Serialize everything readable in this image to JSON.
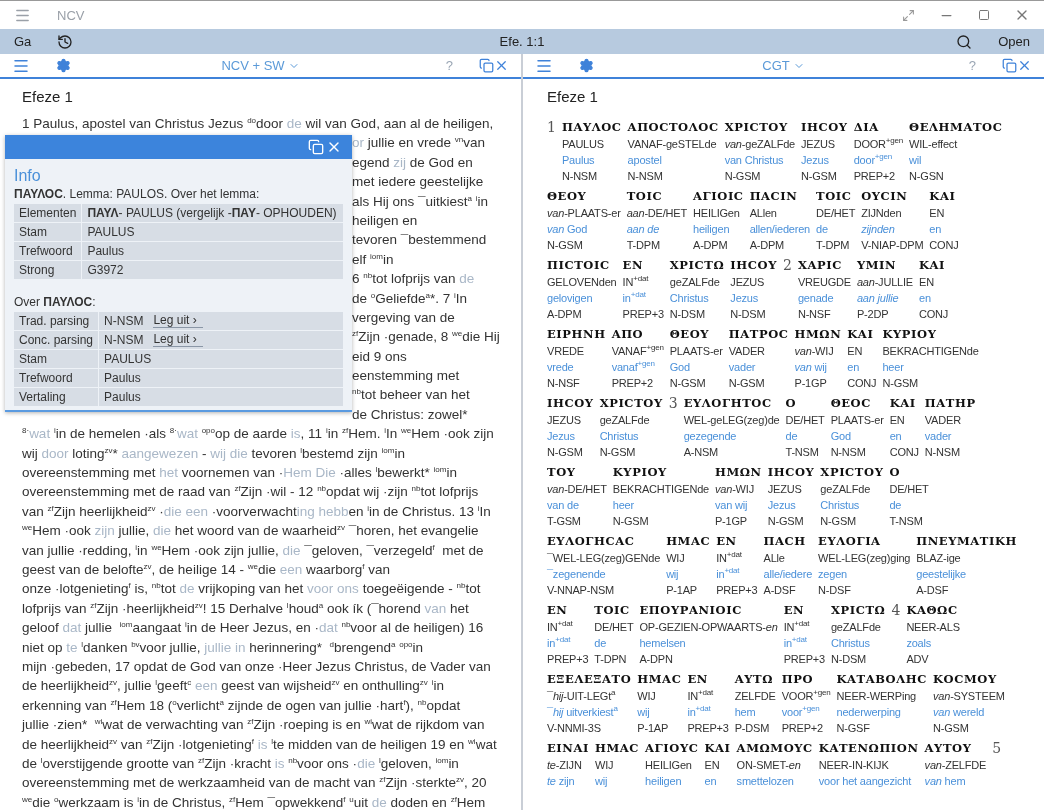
{
  "window": {
    "title": "NCV"
  },
  "toolbar": {
    "go": "Ga",
    "reference": "Efe. 1:1",
    "open": "Open"
  },
  "left_panel": {
    "version": "NCV + SW",
    "help": "?",
    "heading": "Efeze 1",
    "lines": [
      {
        "covered": false,
        "parts": [
          {
            "text": "1 Paulus, apostel van Christus Jezus $^{do}$door ",
            "faded": false
          },
          {
            "text": "de",
            "faded": true
          },
          {
            "text": " wil van God, aan al de heiligen,",
            "faded": false
          }
        ]
      },
      {
        "covered": true,
        "parts": [
          {
            "text": "or",
            "faded": true
          },
          {
            "text": " jullie en vrede $^{vn}$van",
            "faded": false
          }
        ]
      },
      {
        "covered": true,
        "parts": [
          {
            "text": "egend ",
            "faded": false
          },
          {
            "text": "zij",
            "faded": true
          },
          {
            "text": " de God en",
            "faded": false
          }
        ]
      },
      {
        "covered": true,
        "parts": [
          {
            "text": "met iedere geestelijke",
            "faded": false
          }
        ]
      },
      {
        "covered": true,
        "parts": [
          {
            "text": "als Hij ons ¯uitkiest$^{a}$ $^{i}$in",
            "faded": false
          }
        ]
      },
      {
        "covered": true,
        "parts": [
          {
            "text": "heiligen en",
            "faded": false
          }
        ]
      },
      {
        "covered": true,
        "parts": [
          {
            "text": "tevoren ¯bestemmend",
            "faded": false
          }
        ]
      },
      {
        "covered": true,
        "parts": [
          {
            "text": "elf $^{iom}$in",
            "faded": false
          }
        ]
      },
      {
        "covered": true,
        "parts": [
          {
            "text": "6 $^{nb}$tot lofprijs van ",
            "faded": false
          },
          {
            "text": "de",
            "faded": true
          }
        ]
      },
      {
        "covered": true,
        "parts": [
          {
            "text": "de $^{o}$Geliefde$^{a}$*. 7 $^{i}$In",
            "faded": false
          }
        ]
      },
      {
        "covered": true,
        "parts": [
          {
            "text": "vergeving van de",
            "faded": false
          }
        ]
      },
      {
        "covered": true,
        "parts": [
          {
            "text": "$^{zf}$Zijn ·genade, 8 $^{we}$die Hij",
            "faded": false
          }
        ]
      },
      {
        "covered": true,
        "parts": [
          {
            "text": "eid 9 ons",
            "faded": false
          }
        ]
      },
      {
        "covered": true,
        "parts": [
          {
            "text": "eenstemming met",
            "faded": false
          }
        ]
      },
      {
        "covered": true,
        "parts": [
          {
            "text": "$^{nb}$tot beheer van het",
            "faded": false
          }
        ]
      },
      {
        "covered": true,
        "parts": [
          {
            "text": "de Christus: zowel*",
            "faded": false
          }
        ]
      },
      {
        "covered": false,
        "parts": [
          {
            "text": "$^{8·}$",
            "faded": false
          },
          {
            "text": "wat",
            "faded": true
          },
          {
            "text": " $^{i}$in de hemelen ·als $^{8·}$",
            "faded": false
          },
          {
            "text": "wat",
            "faded": true
          },
          {
            "text": " $^{opo}$op de aarde ",
            "faded": false
          },
          {
            "text": "is",
            "faded": true
          },
          {
            "text": ", 11 $^{i}$in $^{zf}$Hem. $^{i}$In $^{we}$Hem ·ook zijn",
            "faded": false
          }
        ]
      },
      {
        "covered": false,
        "parts": [
          {
            "text": "wij ",
            "faded": false
          },
          {
            "text": "door",
            "faded": true
          },
          {
            "text": " loting$^{zv}$* ",
            "faded": false
          },
          {
            "text": "aangewezen",
            "faded": true
          },
          {
            "text": " - ",
            "faded": false
          },
          {
            "text": "wij die",
            "faded": true
          },
          {
            "text": " tevoren $^{l}$bestemd zijn $^{iom}$in",
            "faded": false
          }
        ]
      },
      {
        "covered": false,
        "parts": [
          {
            "text": "overeenstemming met ",
            "faded": false
          },
          {
            "text": "het",
            "faded": true
          },
          {
            "text": " voornemen van ·",
            "faded": false
          },
          {
            "text": "Hem Die",
            "faded": true
          },
          {
            "text": " ·alles $^{l}$bewerkt* $^{iom}$in",
            "faded": false
          }
        ]
      },
      {
        "covered": false,
        "parts": [
          {
            "text": "overeenstemming met de raad van $^{zf}$Zijn ·wil - 12 $^{nb}$opdat wij ·zijn $^{nb}$tot lofprijs",
            "faded": false
          }
        ]
      },
      {
        "covered": false,
        "parts": [
          {
            "text": "van $^{zf}$Zijn heerlijkheid$^{zv}$ ·",
            "faded": false
          },
          {
            "text": "die een",
            "faded": true
          },
          {
            "text": " ·voorverwacht",
            "faded": false
          },
          {
            "text": "ing hebb",
            "faded": true
          },
          {
            "text": "en $^{i}$in de Christus. 13 $^{i}$In",
            "faded": false
          }
        ]
      },
      {
        "covered": false,
        "parts": [
          {
            "text": "$^{we}$Hem ·ook ",
            "faded": false
          },
          {
            "text": "zijn",
            "faded": true
          },
          {
            "text": " jullie, ",
            "faded": false
          },
          {
            "text": "die",
            "faded": true
          },
          {
            "text": " het woord van de waarheid$^{zv}$ ¯horen, het evangelie",
            "faded": false
          }
        ]
      },
      {
        "covered": false,
        "parts": [
          {
            "text": "van jullie ·redding, $^{i}$in $^{we}$Hem ·ook zijn jullie, ",
            "faded": false
          },
          {
            "text": "die",
            "faded": true
          },
          {
            "text": " ¯geloven, ¯verzegeld$^{f}$  met de",
            "faded": false
          }
        ]
      },
      {
        "covered": false,
        "parts": [
          {
            "text": "geest van de belofte$^{zv}$, de heilige 14 - $^{we}$die ",
            "faded": false
          },
          {
            "text": "een",
            "faded": true
          },
          {
            "text": " waarborg$^{f}$ van",
            "faded": false
          }
        ]
      },
      {
        "covered": false,
        "parts": [
          {
            "text": "onze ·lotgenieting$^{f}$ is, $^{nb}$tot ",
            "faded": false
          },
          {
            "text": "de",
            "faded": true
          },
          {
            "text": " vrijkoping van het ",
            "faded": false
          },
          {
            "text": "voor ons",
            "faded": true
          },
          {
            "text": " toegeëigende - $^{nb}$tot",
            "faded": false
          }
        ]
      },
      {
        "covered": false,
        "parts": [
          {
            "text": "lofprijs van $^{zf}$Zijn ·heerlijkheid$^{zv}$! 15 Derhalve $^{l}$houd$^{a}$ ook ík (¯horend ",
            "faded": false
          },
          {
            "text": "van",
            "faded": true
          },
          {
            "text": " het",
            "faded": false
          }
        ]
      },
      {
        "covered": false,
        "parts": [
          {
            "text": "geloof ",
            "faded": false
          },
          {
            "text": "dat",
            "faded": true
          },
          {
            "text": " jullie  $^{iom}$aangaat $^{i}$in de Heer Jezus, en ·",
            "faded": false
          },
          {
            "text": "dat",
            "faded": true
          },
          {
            "text": " $^{nb}$voor al de heiligen) 16",
            "faded": false
          }
        ]
      },
      {
        "covered": false,
        "parts": [
          {
            "text": "niet op ",
            "faded": false
          },
          {
            "text": "te",
            "faded": true
          },
          {
            "text": " $^{l}$danken $^{bv}$voor jullie, ",
            "faded": false
          },
          {
            "text": "jullie in",
            "faded": true
          },
          {
            "text": " herinnering*  $^{d}$brengend$^{a}$ $^{opo}$in",
            "faded": false
          }
        ]
      },
      {
        "covered": false,
        "parts": [
          {
            "text": "mijn ·gebeden, 17 opdat de God van onze ·Heer Jezus Christus, de Vader van",
            "faded": false
          }
        ]
      },
      {
        "covered": false,
        "parts": [
          {
            "text": "de heerlijkheid$^{zv}$, jullie $^{l}$geeft$^{c}$ ",
            "faded": false
          },
          {
            "text": "een",
            "faded": true
          },
          {
            "text": " geest van wijsheid$^{zv}$ en onthulling$^{zv}$ $^{i}$in",
            "faded": false
          }
        ]
      },
      {
        "covered": false,
        "parts": [
          {
            "text": "erkenning van $^{zf}$Hem 18 ($^{o}$verlicht$^{a}$ zijnde de ogen van jullie ·hart$^{f}$), $^{nb}$opdat",
            "faded": false
          }
        ]
      },
      {
        "covered": false,
        "parts": [
          {
            "text": "jullie ·zien*  $^{wi}$wat de verwachting van $^{zf}$Zijn ·roeping is en $^{wi}$wat de rijkdom van",
            "faded": false
          }
        ]
      },
      {
        "covered": false,
        "parts": [
          {
            "text": "de heerlijkheid$^{zv}$ van $^{zf}$Zijn ·lotgenieting$^{f}$ ",
            "faded": false
          },
          {
            "text": "is",
            "faded": true
          },
          {
            "text": " $^{l}$te midden van de heiligen 19 en $^{wi}$wat",
            "faded": false
          }
        ]
      },
      {
        "covered": false,
        "parts": [
          {
            "text": "de $^{l}$overstijgende grootte van $^{zf}$Zijn ·kracht ",
            "faded": false
          },
          {
            "text": "is",
            "faded": true
          },
          {
            "text": " $^{nb}$voor ons ·",
            "faded": false
          },
          {
            "text": "die",
            "faded": true
          },
          {
            "text": " $^{l}$geloven, $^{iom}$in",
            "faded": false
          }
        ]
      },
      {
        "covered": false,
        "parts": [
          {
            "text": "overeenstemming met de werkzaamheid van de macht van $^{zf}$Zijn ·sterkte$^{zv}$, 20",
            "faded": false
          }
        ]
      },
      {
        "covered": false,
        "parts": [
          {
            "text": "$^{we}$die $^{o}$werkzaam is $^{i}$in de Christus, $^{zf}$Hem ¯opwekkend$^{f}$ $^{u}$uit ",
            "faded": false
          },
          {
            "text": "de",
            "faded": true
          },
          {
            "text": " doden en $^{zf}$Hem",
            "faded": false
          }
        ]
      }
    ]
  },
  "info_popup": {
    "title": "Info",
    "lemma": "**ΠΑΥΛΟϹ**. Lemma: PAULOS. Over het lemma:",
    "lemma_rows": [
      {
        "label": "Elementen",
        "value": "**ΠΑΥΛ**- PAULUS (vergelijk -**ΠΑΥ**- OPHOUDEN)"
      },
      {
        "label": "Stam",
        "value": "PAULUS"
      },
      {
        "label": "Trefwoord",
        "value": "Paulus"
      },
      {
        "label": "Strong",
        "value": "G3972"
      }
    ],
    "word_heading": "Over **ΠΑΥΛΟϹ**:",
    "word_rows": [
      {
        "label": "Trad. parsing",
        "value": "N-NSM",
        "action": "Leg uit ›"
      },
      {
        "label": "Conc. parsing",
        "value": "N-NSM",
        "action": "Leg uit ›"
      },
      {
        "label": "Stam",
        "value": "PAULUS"
      },
      {
        "label": "Trefwoord",
        "value": "Paulus"
      },
      {
        "label": "Vertaling",
        "value": "Paulus"
      }
    ]
  },
  "right_panel": {
    "version": "CGT",
    "help": "?",
    "heading": "Efeze 1",
    "lines": [
      {
        "items": [
          {
            "kind": "verse",
            "number": "1"
          },
          {
            "kind": "word",
            "greek": "ΠΑΥΛΟϹ",
            "literal": "PAULUS",
            "translation": "Paulus",
            "parsing": "N-NSM"
          },
          {
            "kind": "word",
            "greek": "ΑΠΟϹΤΟΛΟϹ",
            "literal": "VANAF-geSTELde",
            "translation": "apostel",
            "parsing": "N-NSM"
          },
          {
            "kind": "word",
            "greek": "ΧΡΙϹΤΟΥ",
            "literal": "*van*-geZALFde",
            "translation": "van Christus",
            "parsing": "N-GSM"
          },
          {
            "kind": "word",
            "greek": "ΙΗϹΟΥ",
            "literal": "JEZUS",
            "translation": "Jezus",
            "parsing": "N-GSM"
          },
          {
            "kind": "word",
            "greek": "ΔΙΑ",
            "literal": "DOOR$^{+gen}$",
            "translation": "door$^{+gen}$",
            "parsing": "PREP+2"
          },
          {
            "kind": "word",
            "greek": "ΘΕΛΗΜΑΤΟϹ",
            "literal": "WIL-effect",
            "translation": "wil",
            "parsing": "N-GSN"
          }
        ]
      },
      {
        "items": [
          {
            "kind": "word",
            "greek": "ΘΕΟΥ",
            "literal": "*van*-PLAATS-er",
            "translation": "*van* God",
            "parsing": "N-GSM"
          },
          {
            "kind": "word",
            "greek": "ΤΟΙϹ",
            "literal": "*aan*-DE/HET",
            "translation": "*aan de*",
            "parsing": "T-DPM"
          },
          {
            "kind": "word",
            "greek": "ΑΓΙΟΙϹ",
            "literal": "HEILIGen",
            "translation": "heiligen",
            "parsing": "A-DPM"
          },
          {
            "kind": "word",
            "greek": "ΠΑϹΙΝ",
            "literal": "ALlen",
            "translation": "allen/iederen",
            "parsing": "A-DPM"
          },
          {
            "kind": "word",
            "greek": "ΤΟΙϹ",
            "literal": "DE/HET",
            "translation": "de",
            "parsing": "T-DPM"
          },
          {
            "kind": "word",
            "greek": "ΟΥϹΙΝ",
            "literal": "ZIJNden",
            "translation": "*zijnden*",
            "parsing": "V-NIAP-DPM"
          },
          {
            "kind": "word",
            "greek": "ΚΑΙ",
            "literal": "EN",
            "translation": "en",
            "parsing": "CONJ"
          }
        ]
      },
      {
        "items": [
          {
            "kind": "word",
            "greek": "ΠΙϹΤΟΙϹ",
            "literal": "GELOVENden",
            "translation": "gelovigen",
            "parsing": "A-DPM"
          },
          {
            "kind": "word",
            "greek": "ΕΝ",
            "literal": "IN$^{+dat}$",
            "translation": "in$^{+dat}$",
            "parsing": "PREP+3"
          },
          {
            "kind": "word",
            "greek": "ΧΡΙϹΤΩ",
            "literal": "geZALFde",
            "translation": "Christus",
            "parsing": "N-DSM"
          },
          {
            "kind": "word",
            "greek": "ΙΗϹΟΥ",
            "literal": "JEZUS",
            "translation": "Jezus",
            "parsing": "N-DSM"
          },
          {
            "kind": "verse",
            "number": "2"
          },
          {
            "kind": "word",
            "greek": "ΧΑΡΙϹ",
            "literal": "VREUGDE",
            "translation": "genade",
            "parsing": "N-NSF"
          },
          {
            "kind": "word",
            "greek": "ΥΜΙΝ",
            "literal": "*aan*-JULLIE",
            "translation": "*aan jullie*",
            "parsing": "P-2DP"
          },
          {
            "kind": "word",
            "greek": "ΚΑΙ",
            "literal": "EN",
            "translation": "en",
            "parsing": "CONJ"
          }
        ]
      },
      {
        "items": [
          {
            "kind": "word",
            "greek": "ΕΙΡΗΝΗ",
            "literal": "VREDE",
            "translation": "vrede",
            "parsing": "N-NSF"
          },
          {
            "kind": "word",
            "greek": "ΑΠΟ",
            "literal": "VANAF$^{+gen}$",
            "translation": "vanaf$^{+gen}$",
            "parsing": "PREP+2"
          },
          {
            "kind": "word",
            "greek": "ΘΕΟΥ",
            "literal": "PLAATS-er",
            "translation": "God",
            "parsing": "N-GSM"
          },
          {
            "kind": "word",
            "greek": "ΠΑΤΡΟϹ",
            "literal": "VADER",
            "translation": "vader",
            "parsing": "N-GSM"
          },
          {
            "kind": "word",
            "greek": "ΗΜΩΝ",
            "literal": "*van*-WIJ",
            "translation": "*van* wij",
            "parsing": "P-1GP"
          },
          {
            "kind": "word",
            "greek": "ΚΑΙ",
            "literal": "EN",
            "translation": "en",
            "parsing": "CONJ"
          },
          {
            "kind": "word",
            "greek": "ΚΥΡΙΟΥ",
            "literal": "BEKRACHTIGENde",
            "translation": "heer",
            "parsing": "N-GSM"
          }
        ]
      },
      {
        "items": [
          {
            "kind": "word",
            "greek": "ΙΗϹΟΥ",
            "literal": "JEZUS",
            "translation": "Jezus",
            "parsing": "N-GSM"
          },
          {
            "kind": "word",
            "greek": "ΧΡΙϹΤΟΥ",
            "literal": "geZALFde",
            "translation": "Christus",
            "parsing": "N-GSM"
          },
          {
            "kind": "verse",
            "number": "3"
          },
          {
            "kind": "word",
            "greek": "ΕΥΛΟΓΗΤΟϹ",
            "literal": "WEL-geLEG(zeg)de",
            "translation": "gezegende",
            "parsing": "A-NSM"
          },
          {
            "kind": "word",
            "greek": "Ο",
            "literal": "DE/HET",
            "translation": "de",
            "parsing": "T-NSM"
          },
          {
            "kind": "word",
            "greek": "ΘΕΟϹ",
            "literal": "PLAATS-er",
            "translation": "God",
            "parsing": "N-NSM"
          },
          {
            "kind": "word",
            "greek": "ΚΑΙ",
            "literal": "EN",
            "translation": "en",
            "parsing": "CONJ"
          },
          {
            "kind": "word",
            "greek": "ΠΑΤΗΡ",
            "literal": "VADER",
            "translation": "vader",
            "parsing": "N-NSM"
          }
        ]
      },
      {
        "items": [
          {
            "kind": "word",
            "greek": "ΤΟΥ",
            "literal": "*van*-DE/HET",
            "translation": "van de",
            "parsing": "T-GSM"
          },
          {
            "kind": "word",
            "greek": "ΚΥΡΙΟΥ",
            "literal": "BEKRACHTIGENde",
            "translation": "heer",
            "parsing": "N-GSM"
          },
          {
            "kind": "word",
            "greek": "ΗΜΩΝ",
            "literal": "*van*-WIJ",
            "translation": "van wij",
            "parsing": "P-1GP"
          },
          {
            "kind": "word",
            "greek": "ΙΗϹΟΥ",
            "literal": "JEZUS",
            "translation": "Jezus",
            "parsing": "N-GSM"
          },
          {
            "kind": "word",
            "greek": "ΧΡΙϹΤΟΥ",
            "literal": "geZALFde",
            "translation": "Christus",
            "parsing": "N-GSM"
          },
          {
            "kind": "word",
            "greek": "Ο",
            "literal": "DE/HET",
            "translation": "de",
            "parsing": "T-NSM"
          }
        ]
      },
      {
        "items": [
          {
            "kind": "word",
            "greek": "ΕΥΛΟΓΗϹΑϹ",
            "literal": "¯WEL-LEG(zeg)GENde",
            "translation": "¯zegenende",
            "parsing": "V-NNAP-NSM"
          },
          {
            "kind": "word",
            "greek": "ΗΜΑϹ",
            "literal": "WIJ",
            "translation": "wij",
            "parsing": "P-1AP"
          },
          {
            "kind": "word",
            "greek": "ΕΝ",
            "literal": "IN$^{+dat}$",
            "translation": "in$^{+dat}$",
            "parsing": "PREP+3"
          },
          {
            "kind": "word",
            "greek": "ΠΑϹΗ",
            "literal": "ALle",
            "translation": "alle/iedere",
            "parsing": "A-DSF"
          },
          {
            "kind": "word",
            "greek": "ΕΥΛΟΓΙΑ",
            "literal": "WEL-LEG(zeg)ging",
            "translation": "zegen",
            "parsing": "N-DSF"
          },
          {
            "kind": "word",
            "greek": "ΠΝΕΥΜΑΤΙΚΗ",
            "literal": "BLAZ-ige",
            "translation": "geestelijke",
            "parsing": "A-DSF"
          }
        ]
      },
      {
        "items": [
          {
            "kind": "word",
            "greek": "ΕΝ",
            "literal": "IN$^{+dat}$",
            "translation": "in$^{+dat}$",
            "parsing": "PREP+3"
          },
          {
            "kind": "word",
            "greek": "ΤΟΙϹ",
            "literal": "DE/HET",
            "translation": "de",
            "parsing": "T-DPN"
          },
          {
            "kind": "word",
            "greek": "ΕΠΟΥΡΑΝΙΟΙϹ",
            "literal": "OP-GEZIEN-OPWAARTS-*en*",
            "translation": "hemelsen",
            "parsing": "A-DPN"
          },
          {
            "kind": "word",
            "greek": "ΕΝ",
            "literal": "IN$^{+dat}$",
            "translation": "in$^{+dat}$",
            "parsing": "PREP+3"
          },
          {
            "kind": "word",
            "greek": "ΧΡΙϹΤΩ",
            "literal": "geZALFde",
            "translation": "Christus",
            "parsing": "N-DSM"
          },
          {
            "kind": "verse",
            "number": "4"
          },
          {
            "kind": "word",
            "greek": "ΚΑΘΩϹ",
            "literal": "NEER-ALS",
            "translation": "zoals",
            "parsing": "ADV"
          }
        ]
      },
      {
        "items": [
          {
            "kind": "word",
            "greek": "ΕΞΕΛΕΞΑΤΟ",
            "literal": "¯*hij*-UIT-LEGt$^{a}$",
            "translation": "¯*hij* uitverkiest$^{a}$",
            "parsing": "V-NNMI-3S"
          },
          {
            "kind": "word",
            "greek": "ΗΜΑϹ",
            "literal": "WIJ",
            "translation": "wij",
            "parsing": "P-1AP"
          },
          {
            "kind": "word",
            "greek": "ΕΝ",
            "literal": "IN$^{+dat}$",
            "translation": "in$^{+dat}$",
            "parsing": "PREP+3"
          },
          {
            "kind": "word",
            "greek": "ΑΥΤΩ",
            "literal": "ZELFDE",
            "translation": "hem",
            "parsing": "P-DSM"
          },
          {
            "kind": "word",
            "greek": "ΠΡΟ",
            "literal": "VOOR$^{+gen}$",
            "translation": "voor$^{+gen}$",
            "parsing": "PREP+2"
          },
          {
            "kind": "word",
            "greek": "ΚΑΤΑΒΟΛΗϹ",
            "literal": "NEER-WERPing",
            "translation": "nederwerping",
            "parsing": "N-GSF"
          },
          {
            "kind": "word",
            "greek": "ΚΟϹΜΟΥ",
            "literal": "*van*-SYSTEEM",
            "translation": "*van* wereld",
            "parsing": "N-GSM"
          }
        ]
      },
      {
        "items": [
          {
            "kind": "word",
            "greek": "ΕΙΝΑΙ",
            "literal": "*te*-ZIJN",
            "translation": "*te* zijn"
          },
          {
            "kind": "word",
            "greek": "ΗΜΑϹ",
            "literal": "WIJ",
            "translation": "wij"
          },
          {
            "kind": "word",
            "greek": "ΑΓΙΟΥϹ",
            "literal": "HEILIGen",
            "translation": "heiligen"
          },
          {
            "kind": "word",
            "greek": "ΚΑΙ",
            "literal": "EN",
            "translation": "en"
          },
          {
            "kind": "word",
            "greek": "ΑΜΩΜΟΥϹ",
            "literal": "ON-SMET-*en*",
            "translation": "smettelozen"
          },
          {
            "kind": "word",
            "greek": "ΚΑΤΕΝΩΠΙΟΝ",
            "literal": "NEER-IN-KIJK",
            "translation": "voor het aangezicht"
          },
          {
            "kind": "word",
            "greek": "ΑΥΤΟΥ",
            "literal": "*van*-ZELFDE",
            "translation": "*van* hem"
          },
          {
            "kind": "verse",
            "number": "5"
          }
        ]
      }
    ]
  }
}
